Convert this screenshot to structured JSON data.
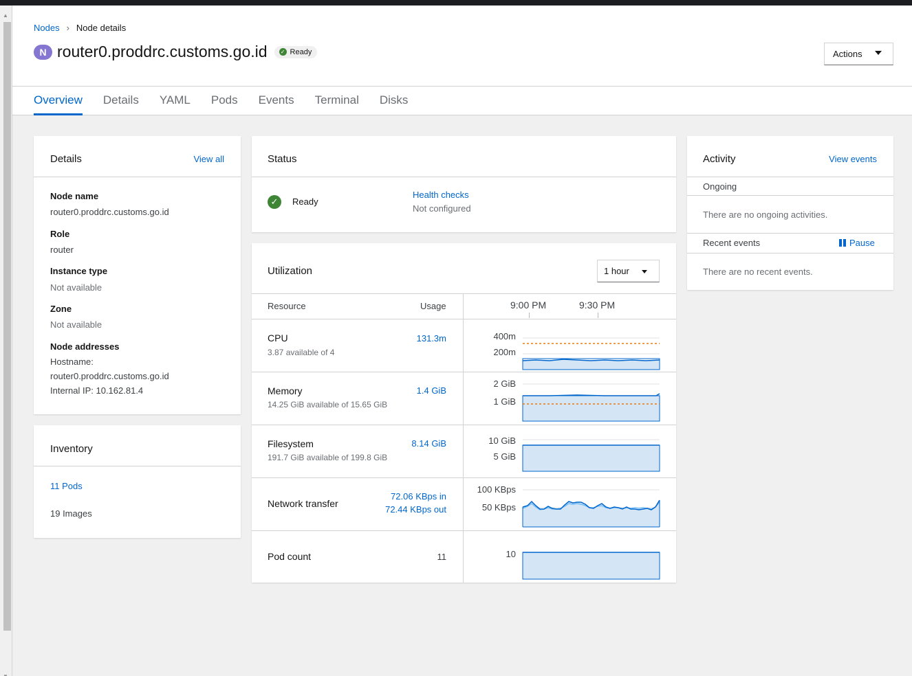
{
  "breadcrumb": {
    "parent": "Nodes",
    "separator": "›",
    "current": "Node details"
  },
  "node": {
    "badge": "N",
    "name": "router0.proddrc.customs.go.id",
    "status": "Ready"
  },
  "actions": {
    "label": "Actions"
  },
  "tabs": [
    "Overview",
    "Details",
    "YAML",
    "Pods",
    "Events",
    "Terminal",
    "Disks"
  ],
  "details_card": {
    "title": "Details",
    "link": "View all",
    "fields": [
      {
        "label": "Node name",
        "value": "router0.proddrc.customs.go.id"
      },
      {
        "label": "Role",
        "value": "router"
      },
      {
        "label": "Instance type",
        "value": "Not available"
      },
      {
        "label": "Zone",
        "value": "Not available"
      }
    ],
    "addresses": {
      "label": "Node addresses",
      "hostname_label": "Hostname:",
      "hostname": "router0.proddrc.customs.go.id",
      "internal_ip": "Internal IP: 10.162.81.4"
    }
  },
  "inventory": {
    "title": "Inventory",
    "pods": "11 Pods",
    "images": "19 Images"
  },
  "status_card": {
    "title": "Status",
    "status": "Ready",
    "health_checks": "Health checks",
    "health_state": "Not configured"
  },
  "utilization": {
    "title": "Utilization",
    "range": "1 hour",
    "col_resource": "Resource",
    "col_usage": "Usage",
    "time_ticks": [
      "9:00 PM",
      "9:30 PM"
    ],
    "rows": [
      {
        "name": "CPU",
        "sub": "3.87 available of 4",
        "usage": "131.3m",
        "usage2": "",
        "ticks": [
          "400m",
          "200m"
        ]
      },
      {
        "name": "Memory",
        "sub": "14.25 GiB available of 15.65 GiB",
        "usage": "1.4 GiB",
        "usage2": "",
        "ticks": [
          "2 GiB",
          "1 GiB"
        ]
      },
      {
        "name": "Filesystem",
        "sub": "191.7 GiB available of 199.8 GiB",
        "usage": "8.14 GiB",
        "usage2": "",
        "ticks": [
          "10 GiB",
          "5 GiB"
        ]
      },
      {
        "name": "Network transfer",
        "sub": "",
        "usage": "72.06 KBps in",
        "usage2": "72.44 KBps out",
        "ticks": [
          "100 KBps",
          "50 KBps"
        ]
      },
      {
        "name": "Pod count",
        "sub": "",
        "usage": "11",
        "usage2": "",
        "ticks": [
          "10",
          ""
        ]
      }
    ]
  },
  "activity": {
    "title": "Activity",
    "link": "View events",
    "ongoing_label": "Ongoing",
    "ongoing_empty": "There are no ongoing activities.",
    "recent_label": "Recent events",
    "pause": "Pause",
    "recent_empty": "There are no recent events."
  },
  "colors": {
    "accent": "#0066cc",
    "success": "#3e8635",
    "area_fill": "#d4e5f6",
    "limit_line": "#ec7a08",
    "node_badge": "#8476d1"
  }
}
